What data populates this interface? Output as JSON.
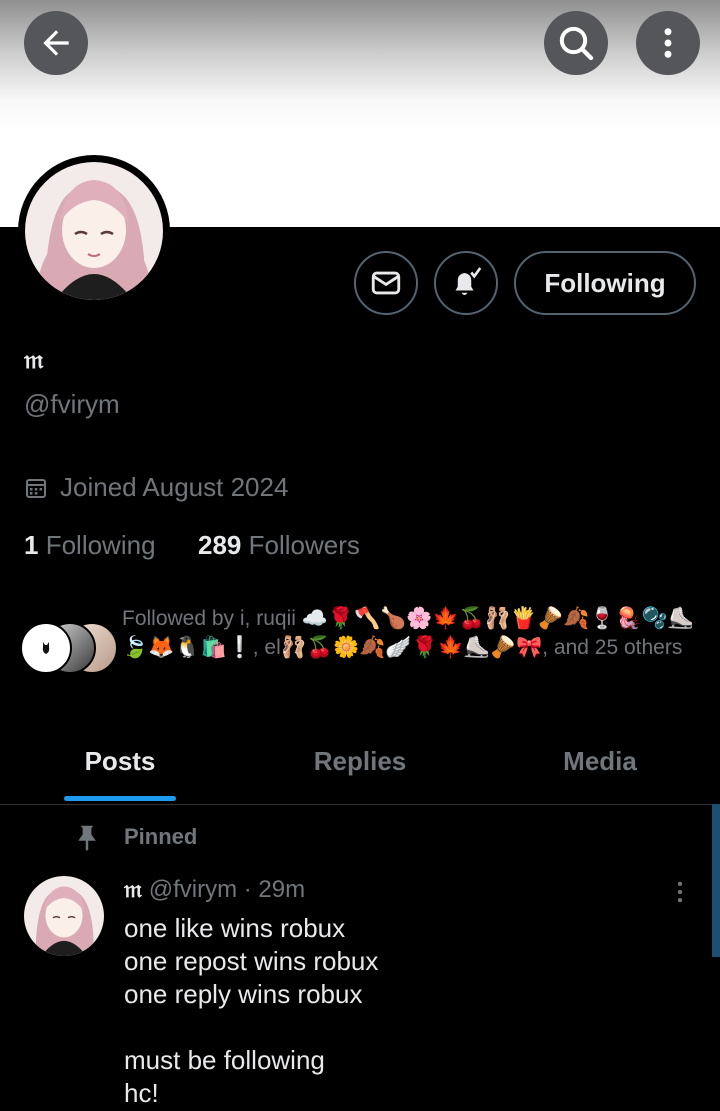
{
  "header": {
    "back_icon": "arrow-left-icon",
    "search_icon": "search-icon",
    "more_icon": "more-vertical-icon"
  },
  "profile": {
    "name": "𝔪",
    "handle": "@fvirym",
    "joined": "Joined August 2024",
    "following_count": "1",
    "following_label": "Following",
    "followers_count": "289",
    "followers_label": "Followers",
    "followed_by": "Followed by i, ruqii ☁️🌹🪓🍗🌸🍁🍒🩰🍟🪘🍂🍷🪼🫧⛸️🍃🦊🐧🛍️❕, el🩰🍒🌼🍂🪽🌹🍁⛸️🪘🎀, and 25 others"
  },
  "actions": {
    "message_icon": "mail-icon",
    "notify_icon": "bell-check-icon",
    "follow_label": "Following"
  },
  "tabs": [
    {
      "label": "Posts",
      "active": true
    },
    {
      "label": "Replies",
      "active": false
    },
    {
      "label": "Media",
      "active": false
    }
  ],
  "pinned_post": {
    "pinned_label": "Pinned",
    "author_name": "𝔪",
    "author_handle": "@fvirym",
    "time": "· 29m",
    "lines": [
      "one like wins robux",
      "one repost wins robux",
      "one reply wins robux",
      "",
      "must be following",
      "hc!"
    ]
  },
  "colors": {
    "accent": "#1d9bf0",
    "background": "#000000",
    "muted_text": "#71767b",
    "border": "#536471"
  }
}
